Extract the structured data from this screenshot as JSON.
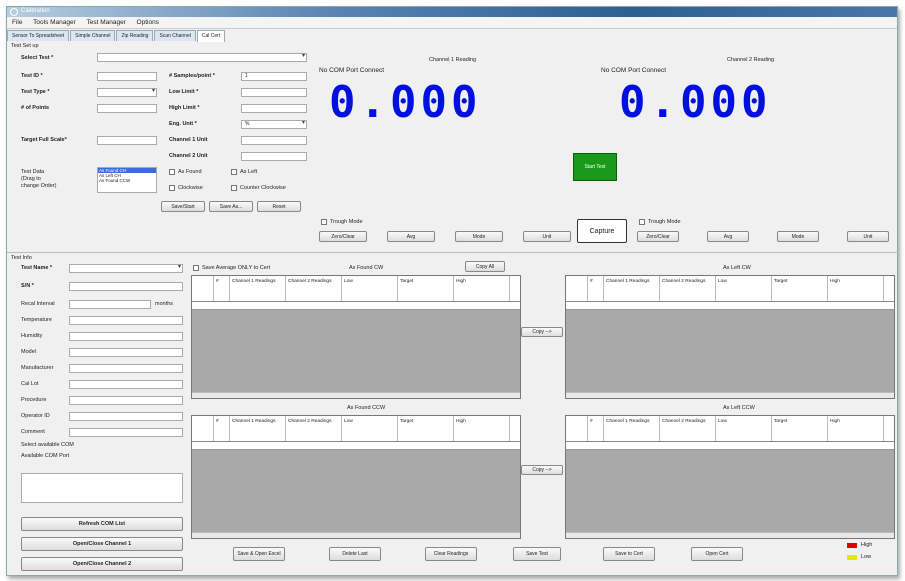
{
  "window": {
    "title": "Calibration"
  },
  "menu": [
    "File",
    "Tools Manager",
    "Test Manager",
    "Options"
  ],
  "tabs": [
    "Sensor To Spreadsheet",
    "Simple Channel",
    "Zip Reading",
    "Scan Channel",
    "Cal Cert"
  ],
  "test_setup": {
    "group": "Test Set up",
    "select_test": "Select Test *",
    "test_id": "Test ID *",
    "test_type": "Test Type *",
    "points": "# of Points",
    "target_full_scale": "Target Full Scale*",
    "samples": "# Samples/point *",
    "samples_value": "1",
    "low_limit": "Low Limit *",
    "high_limit": "High Limit *",
    "eng_unit": "Eng. Unit *",
    "eng_unit_value": "%",
    "ch1_unit": "Channel 1 Unit",
    "ch2_unit": "Channel 2 Unit",
    "test_data": "Test Data",
    "drag_hint": "(Drag to\nchange Order)",
    "list": [
      "As Found CH",
      "As Left CH",
      "As Found CCW"
    ],
    "as_found": "As Found",
    "as_left": "As Left",
    "clockwise": "Clockwise",
    "counter": "Counter Clockwise",
    "btn_save_start": "Save/Start",
    "btn_save_as": "Save As...",
    "btn_reset": "Reset"
  },
  "channel1": {
    "title": "Channel 1 Reading",
    "status": "No COM Port Connect",
    "value": "0.000",
    "trough": "Trough Mode",
    "btns": [
      "Zero/Clear",
      "Avg",
      "Mode",
      "Unit"
    ]
  },
  "channel2": {
    "title": "Channel 2 Reading",
    "status": "No COM Port Connect",
    "value": "0.000",
    "trough": "Trough Mode",
    "btns": [
      "Zero/Clear",
      "Avg",
      "Mode",
      "Unit"
    ]
  },
  "start_test": "Start Test",
  "capture": "Capture",
  "test_info": {
    "group": "Test Info",
    "test_name": "Test Name *",
    "sn": "S/N *",
    "fields": [
      "Recal Interval",
      "Temperature",
      "Humidity",
      "Model",
      "Manufacturer",
      "Cal Lot",
      "Procedure",
      "Operator ID",
      "Comment"
    ],
    "months": "months",
    "select_com": "Select available COM",
    "available_com": "Available COM Port",
    "refresh": "Refresh COM List",
    "open1": "Open/Close Channel 1",
    "open2": "Open/Close Channel 2"
  },
  "grids": {
    "save_avg": "Save Average ONLY to Cert",
    "copy_all": "Copy All",
    "copy": "Copy -->",
    "titles": [
      "As Found CW",
      "As Left CW",
      "As Found CCW",
      "As Left CCW"
    ],
    "cols": [
      "#",
      "Channel 1 Readings",
      "Channel 2 Readings",
      "Low",
      "Target",
      "High"
    ]
  },
  "bottom": [
    "Save & Open Excel",
    "Delete Last",
    "Clear Readings",
    "Save Test",
    "Save to Cert",
    "Open Cert"
  ],
  "legend": {
    "high": "High",
    "low": "Low",
    "high_color": "#e00000",
    "low_color": "#e8e800"
  }
}
